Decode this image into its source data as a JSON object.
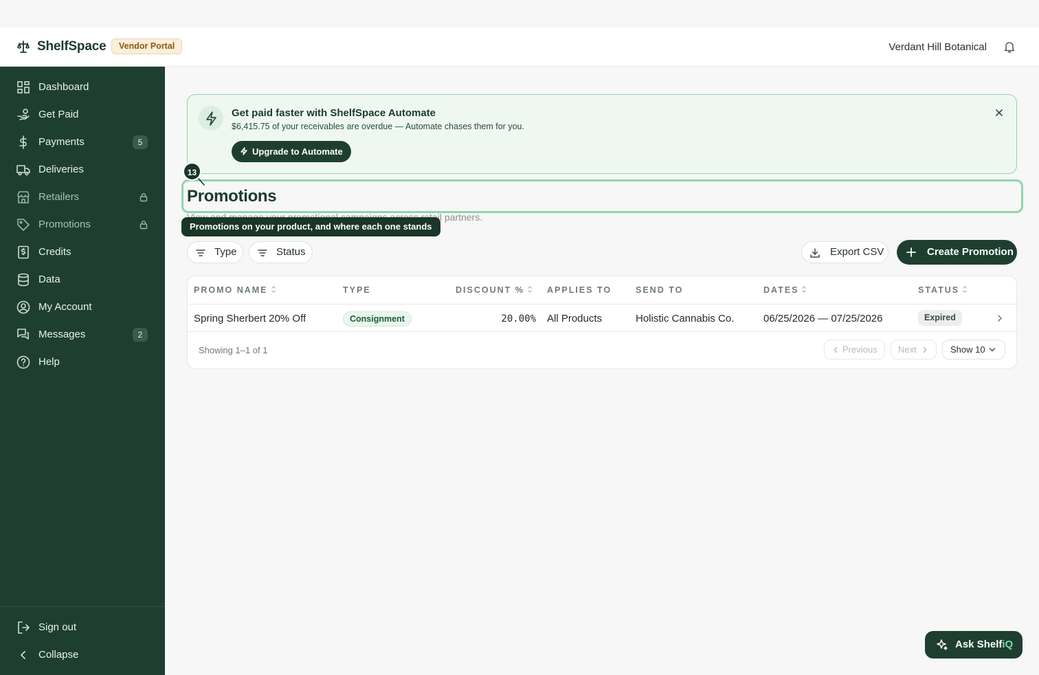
{
  "app": {
    "name": "ShelfSpace",
    "portal_badge": "Vendor Portal",
    "account": "Verdant Hill Botanical"
  },
  "sidebar": {
    "items": [
      {
        "label": "Dashboard",
        "icon": "dashboard-icon"
      },
      {
        "label": "Get Paid",
        "icon": "hand-coins-icon"
      },
      {
        "label": "Payments",
        "icon": "dollar-icon",
        "count": "5"
      },
      {
        "label": "Deliveries",
        "icon": "truck-icon"
      },
      {
        "label": "Retailers",
        "icon": "store-icon",
        "locked": true
      },
      {
        "label": "Promotions",
        "icon": "tag-icon",
        "locked": true
      },
      {
        "label": "Credits",
        "icon": "receipt-icon"
      },
      {
        "label": "Data",
        "icon": "database-icon"
      },
      {
        "label": "My Account",
        "icon": "user-circle-icon"
      },
      {
        "label": "Messages",
        "icon": "messages-icon",
        "count": "2"
      },
      {
        "label": "Help",
        "icon": "help-icon"
      }
    ],
    "footer": [
      {
        "label": "Sign out",
        "icon": "sign-out-icon"
      },
      {
        "label": "Collapse",
        "icon": "chevron-left-icon"
      }
    ]
  },
  "banner": {
    "title": "Get paid faster with ShelfSpace Automate",
    "subtitle": "$6,415.75 of your receivables are overdue — Automate chases them for you.",
    "button": "Upgrade to Automate"
  },
  "page": {
    "title": "Promotions",
    "subtitle": "View and manage your promotional campaigns across retail partners."
  },
  "tour": {
    "step": "13",
    "tooltip": "Promotions on your product, and where each one stands"
  },
  "toolbar": {
    "filter_type": "Type",
    "filter_status": "Status",
    "export": "Export CSV",
    "create": "Create Promotion"
  },
  "table": {
    "columns": [
      "PROMO NAME",
      "TYPE",
      "DISCOUNT %",
      "APPLIES TO",
      "SEND TO",
      "DATES",
      "STATUS"
    ],
    "rows": [
      {
        "name": "Spring Sherbert 20% Off",
        "type": "Consignment",
        "discount": "20.00%",
        "applies_to": "All Products",
        "send_to": "Holistic Cannabis Co.",
        "dates": "06/25/2026 — 07/25/2026",
        "status": "Expired"
      }
    ],
    "footer": {
      "showing": "Showing 1–1 of 1",
      "previous": "Previous",
      "next": "Next",
      "page_size": "Show 10"
    }
  },
  "assistant": {
    "label_main": "Ask Shelf",
    "label_accent": "iQ"
  },
  "colors": {
    "sidebar": "#1e3f30",
    "accent": "#8fd4ae",
    "brand_text": "#1c3a2c"
  }
}
